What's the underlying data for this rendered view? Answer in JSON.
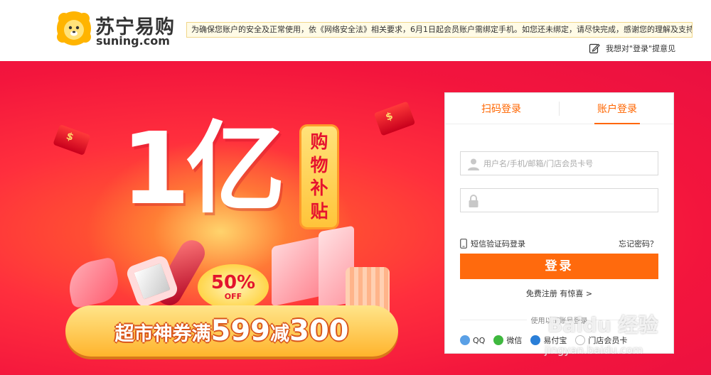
{
  "brand": {
    "name_cn": "苏宁易购",
    "name_en": "suning.com"
  },
  "header": {
    "notice": "为确保您账户的安全及正常使用，依《网络安全法》相关要求，6月1日起会员账户需绑定手机。如您还未绑定，请尽快完成，感谢您的理解及支持！",
    "feedback_label": "我想对\"登录\"提意见"
  },
  "banner": {
    "headline": "1亿",
    "subsidy_chars": [
      "购",
      "物",
      "补",
      "贴"
    ],
    "discount_pct": "50%",
    "discount_off": "OFF",
    "coupon_prefix": "超市神券满",
    "coupon_amount1": "599",
    "coupon_mid": "减",
    "coupon_amount2": "300"
  },
  "login": {
    "tabs": [
      {
        "label": "扫码登录",
        "active": false
      },
      {
        "label": "账户登录",
        "active": true
      }
    ],
    "username_placeholder": "用户名/手机/邮箱/门店会员卡号",
    "password_placeholder": "",
    "sms_login": "短信验证码登录",
    "forgot_password": "忘记密码？",
    "submit_label": "登录",
    "register_label": "免费注册 有惊喜 >",
    "other_title": "使用以下账号登录",
    "socials": [
      {
        "label": "QQ",
        "icon": "qq-icon",
        "color": "#5aa0e6"
      },
      {
        "label": "微信",
        "icon": "wechat-icon",
        "color": "#3fb83f"
      },
      {
        "label": "易付宝",
        "icon": "yifubao-icon",
        "color": "#2a7fd8"
      },
      {
        "label": "门店会员卡",
        "icon": "member-card-icon",
        "color": "#ffffff"
      }
    ]
  },
  "watermark": {
    "main": "Baidu 经验",
    "sub": "jingyan.baidu.com"
  },
  "colors": {
    "accent": "#ff6600",
    "banner": "#ea1041",
    "button": "#ff6a0d"
  }
}
